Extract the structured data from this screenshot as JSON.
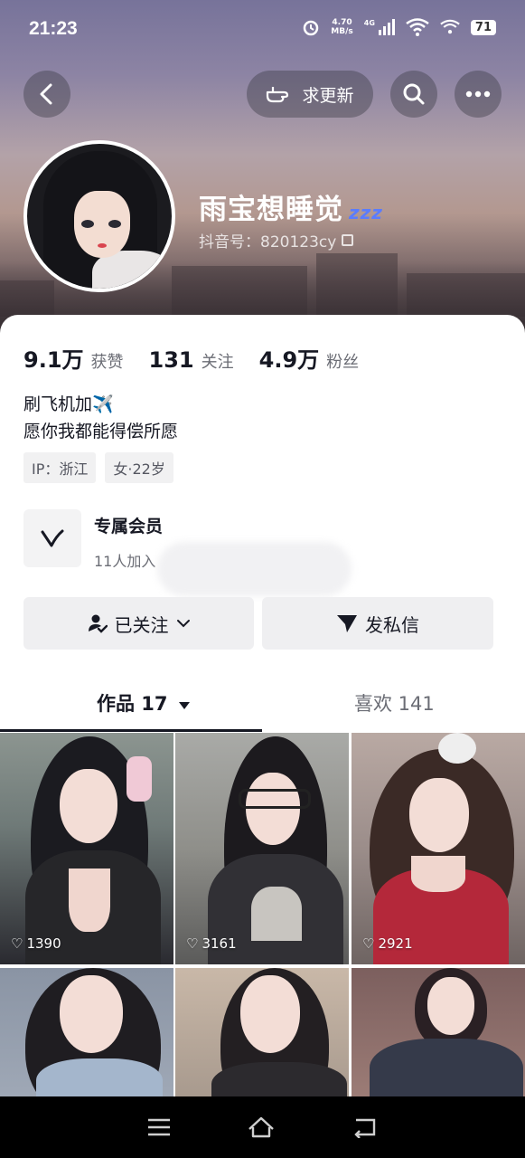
{
  "status_bar": {
    "time": "21:23",
    "net_speed_value": "4.70",
    "net_speed_unit": "MB/s",
    "network": "4G",
    "battery": "71"
  },
  "header": {
    "update_button_label": "求更新"
  },
  "profile": {
    "name": "雨宝想睡觉",
    "name_emoji": "zzz",
    "douyin_id": "抖音号：820123cy"
  },
  "stats": [
    {
      "value": "9.1万",
      "label": "获赞"
    },
    {
      "value": "131",
      "label": "关注"
    },
    {
      "value": "4.9万",
      "label": "粉丝"
    }
  ],
  "bio": {
    "line1": "刷飞机加✈️",
    "line2": "愿你我都能得偿所愿"
  },
  "tags": [
    "IP：浙江",
    "女·22岁"
  ],
  "membership": {
    "title": "专属会员",
    "subtitle": "11人加入"
  },
  "actions": {
    "follow_label": "已关注",
    "message_label": "发私信"
  },
  "tabs": {
    "works": "作品 17",
    "likes": "喜欢 141"
  },
  "videos": [
    {
      "likes": "1390"
    },
    {
      "likes": "3161"
    },
    {
      "likes": "2921"
    },
    {
      "likes": ""
    },
    {
      "likes": ""
    },
    {
      "likes": ""
    }
  ],
  "colors": {
    "text": "#161823",
    "secondary": "#6b6d75",
    "button_bg": "#efeff1"
  }
}
